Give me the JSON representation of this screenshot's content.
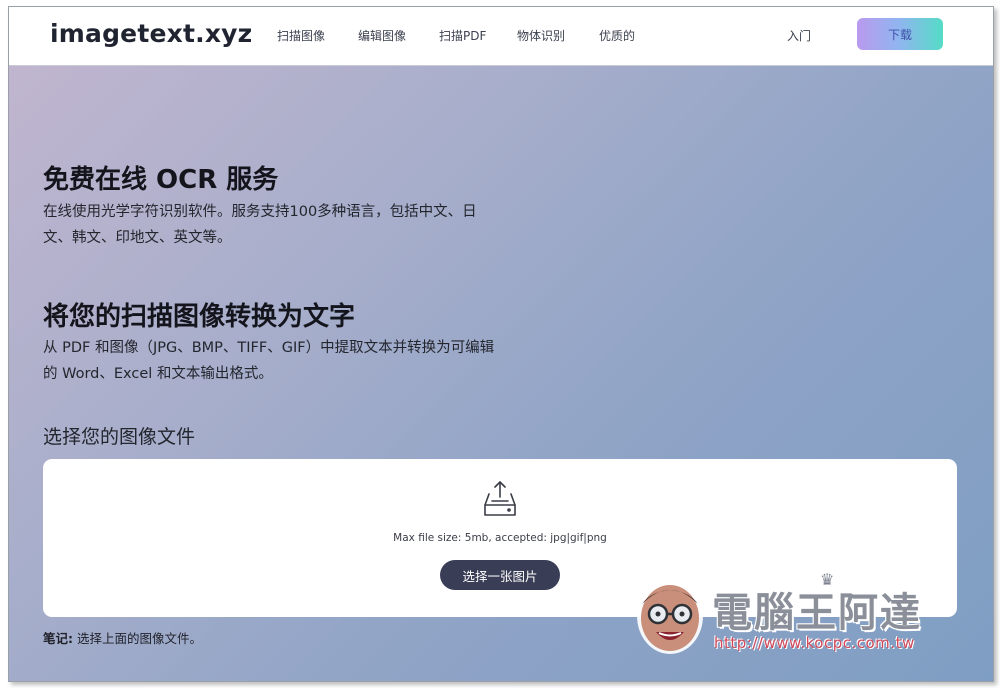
{
  "navbar": {
    "logo": "imagetext.xyz",
    "links": [
      "扫描图像",
      "编辑图像",
      "扫描PDF",
      "物体识别",
      "优质的"
    ],
    "intro": "入门",
    "download": "下载"
  },
  "hero": {
    "title1": "免费在线 OCR 服务",
    "desc1": "在线使用光学字符识别软件。服务支持100多种语言，包括中文、日文、韩文、印地文、英文等。",
    "title2": "将您的扫描图像转换为文字",
    "desc2": "从 PDF 和图像（JPG、BMP、TIFF、GIF）中提取文本并转换为可编辑的 Word、Excel 和文本输出格式。"
  },
  "upload": {
    "label": "选择您的图像文件",
    "icon": "inbox-upload-icon",
    "hint": "Max file size: 5mb, accepted: jpg|gif|png",
    "button": "选择一张图片"
  },
  "note": {
    "prefix": "笔记:",
    "text": " 选择上面的图像文件。"
  },
  "watermark": {
    "brand": "電腦王阿達",
    "url": "http://www.kocpc.com.tw"
  },
  "colors": {
    "download_gradient": [
      "#b999ee",
      "#8fb6ef",
      "#55dcc6"
    ],
    "choose_button": "#3a3d56",
    "background_gradient": [
      "#c3b6cf",
      "#7f9ec3"
    ]
  }
}
